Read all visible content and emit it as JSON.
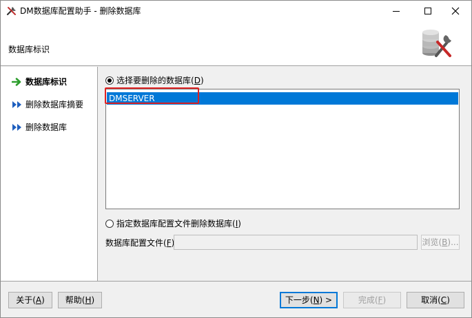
{
  "window": {
    "title": "DM数据库配置助手 - 删除数据库",
    "icon": "tools-icon"
  },
  "header": {
    "title": "数据库标识",
    "icon": "database-tools-icon"
  },
  "nav": {
    "items": [
      {
        "label": "数据库标识",
        "state": "active"
      },
      {
        "label": "删除数据库摘要",
        "state": "pending"
      },
      {
        "label": "删除数据库",
        "state": "pending"
      }
    ]
  },
  "main": {
    "option_select": {
      "prefix": "选择要删除的数据库(",
      "key": "D",
      "suffix": ")",
      "selected": true
    },
    "databases": [
      "DMSERVER"
    ],
    "option_config": {
      "prefix": "指定数据库配置文件删除数据库(",
      "key": "I",
      "suffix": ")",
      "selected": false
    },
    "config_file": {
      "prefix": "数据库配置文件(",
      "key": "F",
      "suffix": "):",
      "value": ""
    },
    "browse": {
      "prefix": "浏览(",
      "key": "B",
      "suffix": ")..."
    }
  },
  "footer": {
    "about": {
      "prefix": "关于(",
      "key": "A",
      "suffix": ")"
    },
    "help": {
      "prefix": "帮助(",
      "key": "H",
      "suffix": ")"
    },
    "next": {
      "prefix": "下一步(",
      "key": "N",
      "suffix": ") >"
    },
    "finish": {
      "prefix": "完成(",
      "key": "F",
      "suffix": ")"
    },
    "cancel": {
      "prefix": "取消(",
      "key": "C",
      "suffix": ")"
    }
  },
  "colors": {
    "selection": "#0078d7",
    "highlight": "#e02020",
    "nav_active_arrow": "#2e9e2e",
    "nav_pending_arrow": "#1e5fbf"
  }
}
